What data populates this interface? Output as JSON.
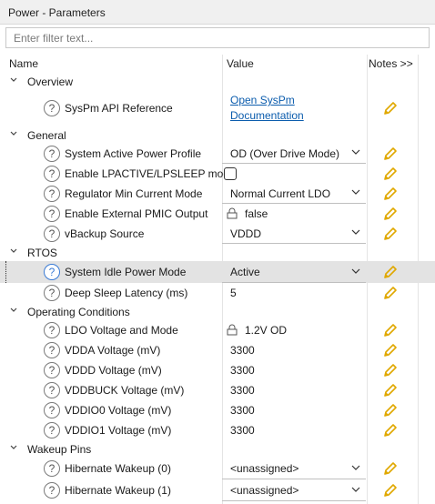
{
  "window": {
    "title": "Power - Parameters"
  },
  "filter": {
    "placeholder": "Enter filter text..."
  },
  "columns": {
    "name": "Name",
    "value": "Value",
    "notes": "Notes >>"
  },
  "categories": {
    "overview": "Overview",
    "general": "General",
    "rtos": "RTOS",
    "operating": "Operating Conditions",
    "wakeup": "Wakeup Pins"
  },
  "params": {
    "syspm_api": {
      "name": "SysPm API Reference",
      "value_line1": "Open SysPm",
      "value_line2": "Documentation"
    },
    "active_profile": {
      "name": "System Active Power Profile",
      "value": "OD (Over Drive Mode)"
    },
    "lpactive": {
      "name": "Enable LPACTIVE/LPSLEEP mode",
      "checked": false
    },
    "reg_min": {
      "name": "Regulator Min Current Mode",
      "value": "Normal Current LDO"
    },
    "ext_pmic": {
      "name": "Enable External PMIC Output",
      "value": "false"
    },
    "vbackup": {
      "name": "vBackup Source",
      "value": "VDDD"
    },
    "idle_mode": {
      "name": "System Idle Power Mode",
      "value": "Active"
    },
    "deep_sleep": {
      "name": "Deep Sleep Latency (ms)",
      "value": "5"
    },
    "ldo_mode": {
      "name": "LDO Voltage and Mode",
      "value": "1.2V OD"
    },
    "vdda": {
      "name": "VDDA Voltage (mV)",
      "value": "3300"
    },
    "vddd": {
      "name": "VDDD Voltage (mV)",
      "value": "3300"
    },
    "vddbuck": {
      "name": "VDDBUCK Voltage (mV)",
      "value": "3300"
    },
    "vddio0": {
      "name": "VDDIO0 Voltage (mV)",
      "value": "3300"
    },
    "vddio1": {
      "name": "VDDIO1 Voltage (mV)",
      "value": "3300"
    },
    "hib0": {
      "name": "Hibernate Wakeup (0)",
      "value": "<unassigned>"
    },
    "hib1": {
      "name": "Hibernate Wakeup (1)",
      "value": "<unassigned>"
    }
  },
  "help_glyph": "?",
  "colors": {
    "pencil": "#e0a800",
    "link": "#0b5cad",
    "selection": "#e3e3e3",
    "help_selected": "#3a7bd5"
  },
  "icons": {
    "help": "question-circle-icon",
    "edit": "pencil-icon",
    "lock": "lock-icon",
    "expand": "chevron-down-icon",
    "dropdown": "caret-down-icon"
  }
}
